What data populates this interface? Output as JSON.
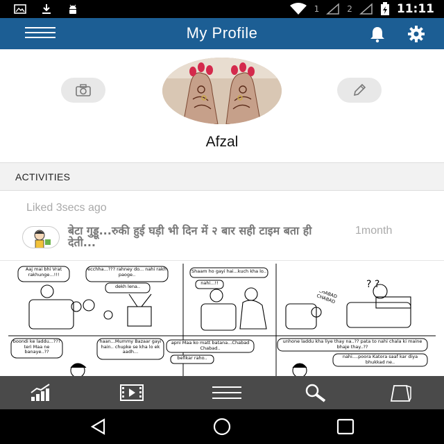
{
  "status_bar": {
    "sim1": "1",
    "sim2": "2",
    "time": "11:11"
  },
  "app_bar": {
    "title": "My Profile"
  },
  "profile": {
    "name": "Afzal"
  },
  "activities": {
    "header": "ACTIVITIES",
    "items": [
      {
        "liked_label": "Liked 3secs ago",
        "post_title": "बेटा गुड्डू...रुकी हुई घड़ी भी दिन में २ बार सही टाइम बता ही देती...",
        "time_ago": "1month"
      }
    ]
  },
  "comic": {
    "bubbles": [
      "Aaj mai bhi Vrat rakhunge...!!!",
      "ecchha...??? rahney do... nahi rakh paoge..",
      "dekh lena..",
      "Shaam ho gayi hai...kuch kha lo..",
      "nahi...!!",
      "CHABAD CHABAD",
      "boondi ke laddu...??? teri Maa ne banaye..??",
      "haan...Mummy Bazaar gayi hain.. chupke se kha lo ek aadh...",
      "apni Maa ko matt batana...Chabad Chabad..",
      "befikar raho..",
      "unhone laddu kha liye thay na..?? pata to nahi chala ki maine bhaje thay..??",
      "nahi....poora Katora saaf kar diya bhukkad ne.."
    ]
  },
  "icons": {
    "status_left": [
      "image-icon",
      "download-icon",
      "android-icon"
    ],
    "status_right": [
      "wifi-icon",
      "signal-icon",
      "battery-icon"
    ],
    "app_bar": [
      "menu-icon",
      "bell-icon",
      "gear-icon"
    ],
    "profile": [
      "camera-icon",
      "pencil-icon"
    ],
    "bottom_nav": [
      "chart-icon",
      "video-icon",
      "list-icon",
      "search-icon",
      "bag-icon"
    ],
    "system_nav": [
      "back-icon",
      "home-icon",
      "recents-icon"
    ]
  },
  "colors": {
    "app_bar": "#1c5e94",
    "bottom_nav": "#4a4a4a",
    "section_header": "#f2f2f2"
  }
}
